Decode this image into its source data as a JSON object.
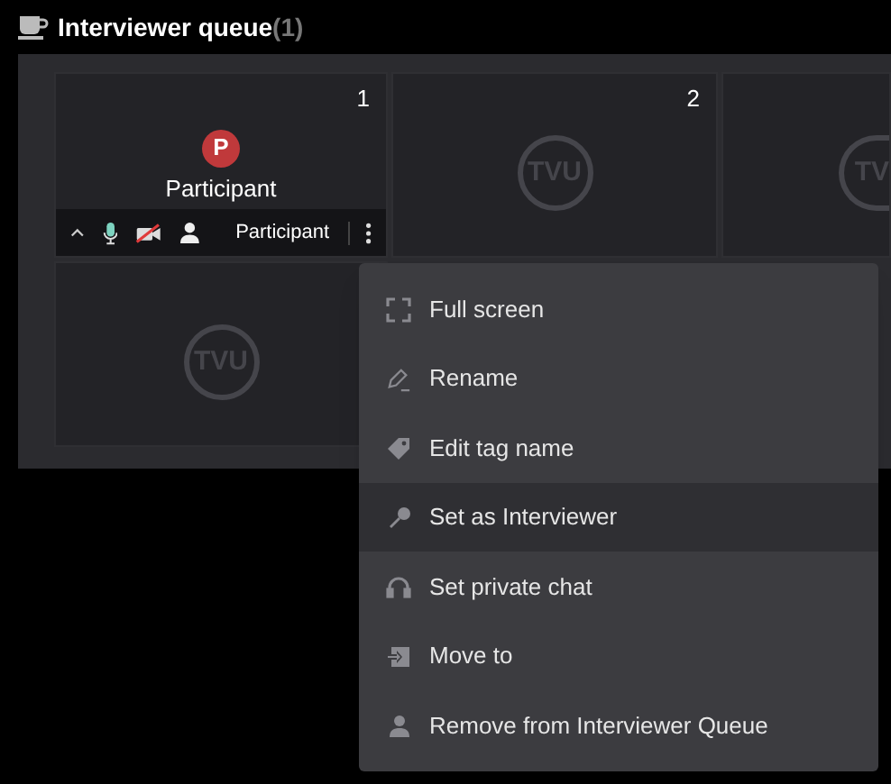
{
  "header": {
    "title": "Interviewer queue",
    "count": "(1)"
  },
  "tiles": [
    {
      "kind": "participant",
      "number": "1",
      "avatar": "P",
      "name": "Participant",
      "toolbar": {
        "role": "Participant",
        "mic_on": true,
        "camera_on": false
      }
    },
    {
      "kind": "empty",
      "number": "2",
      "logo": "TVU"
    },
    {
      "kind": "partial",
      "logo": "TV"
    },
    {
      "kind": "empty",
      "logo": "TVU"
    }
  ],
  "menu": [
    {
      "kind": "fullscreen",
      "label": "Full screen",
      "selected": false
    },
    {
      "kind": "rename",
      "label": "Rename",
      "selected": false
    },
    {
      "kind": "tag",
      "label": "Edit tag name",
      "selected": false
    },
    {
      "kind": "mic",
      "label": "Set as Interviewer",
      "selected": true
    },
    {
      "kind": "headset",
      "label": "Set private chat",
      "selected": false
    },
    {
      "kind": "move",
      "label": "Move to",
      "selected": false
    },
    {
      "kind": "person",
      "label": "Remove from Interviewer Queue",
      "selected": false
    }
  ]
}
